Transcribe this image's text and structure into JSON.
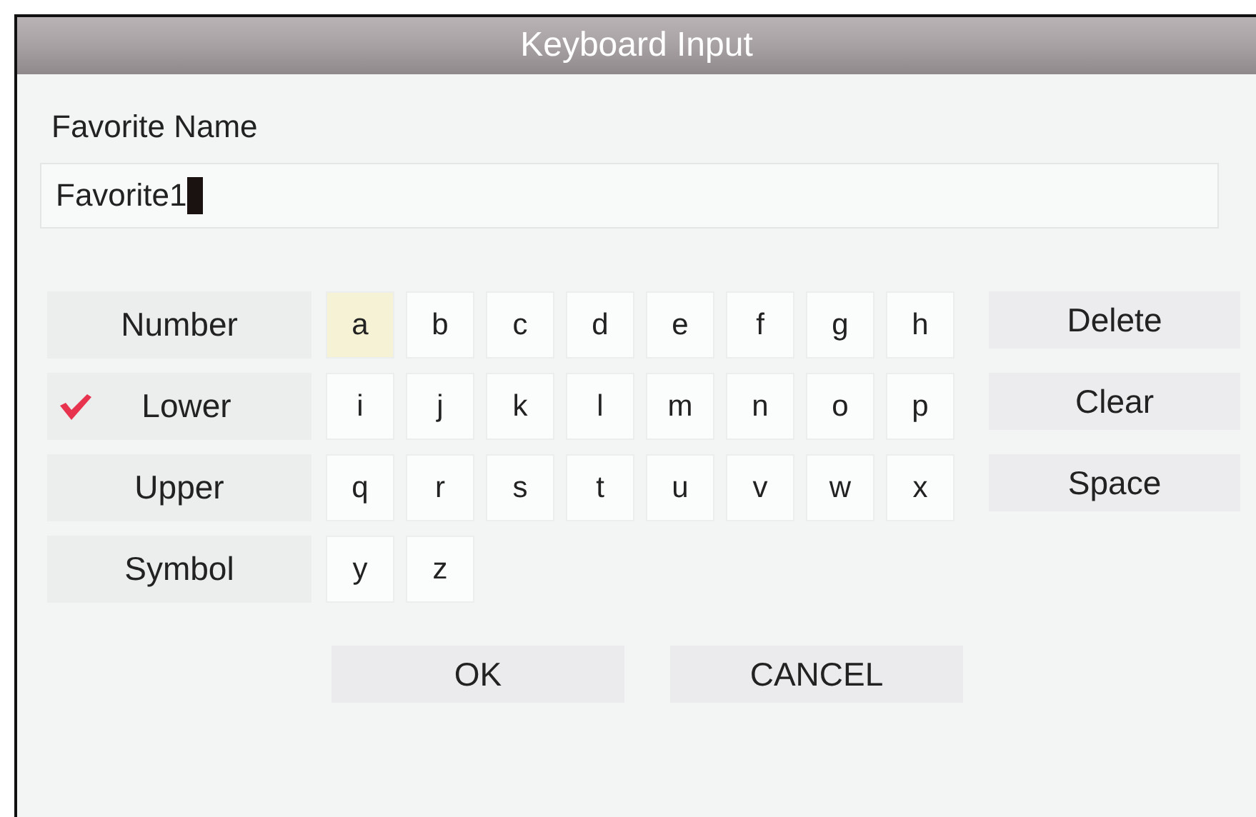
{
  "window": {
    "title": "Keyboard Input"
  },
  "field": {
    "label": "Favorite Name",
    "value": "Favorite1",
    "cursor": true
  },
  "modes": [
    {
      "label": "Number",
      "selected": false
    },
    {
      "label": "Lower",
      "selected": true
    },
    {
      "label": "Upper",
      "selected": false
    },
    {
      "label": "Symbol",
      "selected": false
    }
  ],
  "key_rows": [
    [
      {
        "label": "a",
        "selected": true
      },
      {
        "label": "b",
        "selected": false
      },
      {
        "label": "c",
        "selected": false
      },
      {
        "label": "d",
        "selected": false
      },
      {
        "label": "e",
        "selected": false
      },
      {
        "label": "f",
        "selected": false
      },
      {
        "label": "g",
        "selected": false
      },
      {
        "label": "h",
        "selected": false
      }
    ],
    [
      {
        "label": "i",
        "selected": false
      },
      {
        "label": "j",
        "selected": false
      },
      {
        "label": "k",
        "selected": false
      },
      {
        "label": "l",
        "selected": false
      },
      {
        "label": "m",
        "selected": false
      },
      {
        "label": "n",
        "selected": false
      },
      {
        "label": "o",
        "selected": false
      },
      {
        "label": "p",
        "selected": false
      }
    ],
    [
      {
        "label": "q",
        "selected": false
      },
      {
        "label": "r",
        "selected": false
      },
      {
        "label": "s",
        "selected": false
      },
      {
        "label": "t",
        "selected": false
      },
      {
        "label": "u",
        "selected": false
      },
      {
        "label": "v",
        "selected": false
      },
      {
        "label": "w",
        "selected": false
      },
      {
        "label": "x",
        "selected": false
      }
    ],
    [
      {
        "label": "y",
        "selected": false
      },
      {
        "label": "z",
        "selected": false
      }
    ]
  ],
  "actions": [
    "Delete",
    "Clear",
    "Space"
  ],
  "buttons": [
    "OK",
    "CANCEL"
  ]
}
